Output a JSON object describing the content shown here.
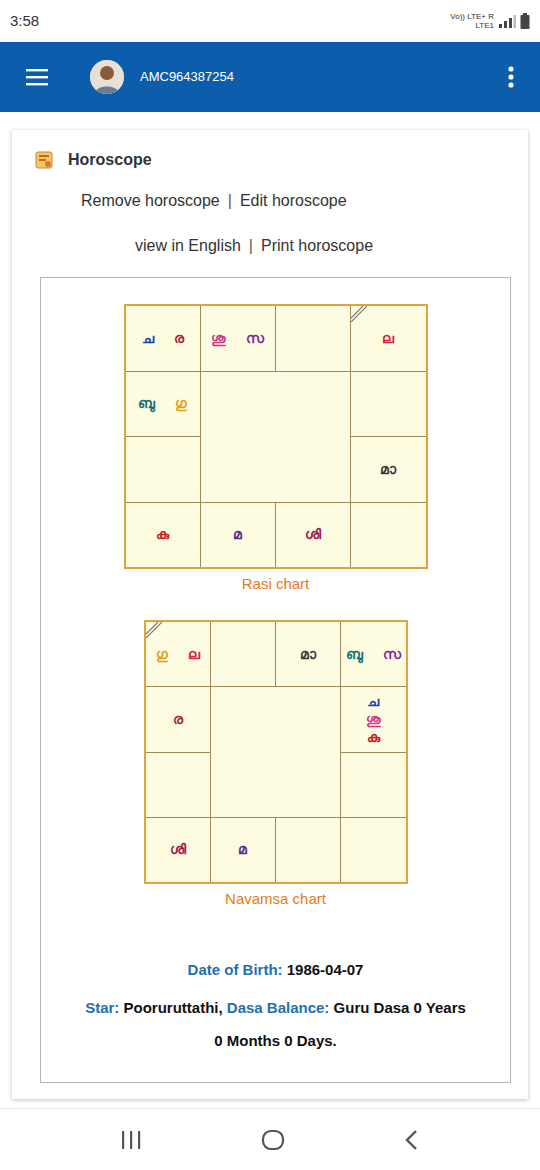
{
  "status_bar": {
    "time": "3:58",
    "network_top": "Vo)) LTE+ R",
    "network_bottom": "LTE1"
  },
  "app_bar": {
    "user": "AMC964387254"
  },
  "card": {
    "title": "Horoscope",
    "link_rows": [
      [
        "Remove horoscope",
        "|",
        "Edit horoscope"
      ],
      [
        "view in English",
        "|",
        "Print horoscope"
      ]
    ]
  },
  "charts": [
    {
      "label": "Rasi chart",
      "cells": [
        {
          "marked": false,
          "planets": [
            {
              "text": "ച",
              "color": "#1d3fae"
            },
            {
              "text": "ര",
              "color": "#a8262b"
            }
          ]
        },
        {
          "marked": false,
          "planets": [
            {
              "text": "ശു",
              "color": "#d3338c"
            },
            {
              "text": "സ",
              "color": "#8a1fa0"
            }
          ]
        },
        {
          "marked": false,
          "planets": []
        },
        {
          "marked": true,
          "planets": [
            {
              "text": "ല",
              "color": "#d7263d"
            }
          ]
        },
        {
          "marked": false,
          "planets": []
        },
        {
          "marked": false,
          "planets": [
            {
              "text": "മാ",
              "color": "#3a3a3a"
            }
          ]
        },
        {
          "marked": false,
          "planets": []
        },
        {
          "marked": false,
          "planets": [
            {
              "text": "ശി",
              "color": "#a3184f"
            }
          ]
        },
        {
          "marked": false,
          "planets": [
            {
              "text": "മ",
              "color": "#5a2d8c"
            }
          ]
        },
        {
          "marked": false,
          "planets": [
            {
              "text": "കു",
              "color": "#c81e1e"
            }
          ]
        },
        {
          "marked": false,
          "planets": []
        },
        {
          "marked": false,
          "planets": [
            {
              "text": "ബു",
              "color": "#137070"
            },
            {
              "text": "ഗു",
              "color": "#e0a017"
            }
          ]
        }
      ]
    },
    {
      "label": "Navamsa chart",
      "cells": [
        {
          "marked": true,
          "planets": [
            {
              "text": "ഗു",
              "color": "#e0a017"
            },
            {
              "text": "ല",
              "color": "#d7263d"
            }
          ]
        },
        {
          "marked": false,
          "planets": []
        },
        {
          "marked": false,
          "planets": [
            {
              "text": "മാ",
              "color": "#3a3a3a"
            }
          ]
        },
        {
          "marked": false,
          "planets": [
            {
              "text": "ബു",
              "color": "#137070"
            },
            {
              "text": "സ",
              "color": "#8a1fa0"
            }
          ]
        },
        {
          "marked": false,
          "planets": [
            {
              "text": "ച",
              "color": "#1d3fae"
            },
            {
              "text": "ശു",
              "color": "#d3338c"
            },
            {
              "text": "കു",
              "color": "#c81e1e"
            }
          ]
        },
        {
          "marked": false,
          "planets": []
        },
        {
          "marked": false,
          "planets": []
        },
        {
          "marked": false,
          "planets": []
        },
        {
          "marked": false,
          "planets": [
            {
              "text": "മ",
              "color": "#5a2d8c"
            }
          ]
        },
        {
          "marked": false,
          "planets": [
            {
              "text": "ശി",
              "color": "#a3184f"
            }
          ]
        },
        {
          "marked": false,
          "planets": []
        },
        {
          "marked": false,
          "planets": [
            {
              "text": "ര",
              "color": "#a8262b"
            }
          ]
        }
      ]
    }
  ],
  "details": {
    "dob_label": "Date of Birth:",
    "dob": "1986-04-07",
    "star_label": "Star:",
    "star": "Pooruruttathi,",
    "dasa_label": "Dasa Balance:",
    "dasa_line1": "Guru Dasa 0 Years",
    "dasa_line2": "0 Months 0 Days."
  }
}
